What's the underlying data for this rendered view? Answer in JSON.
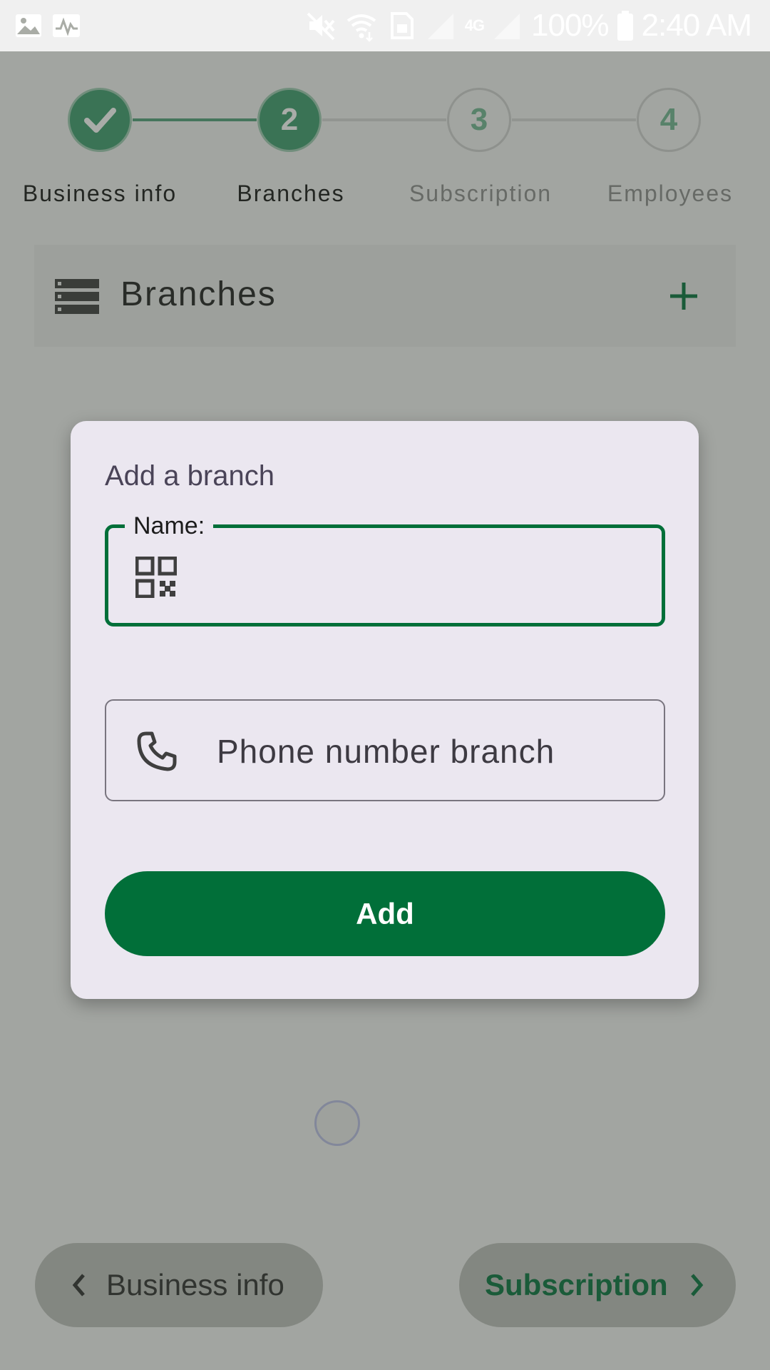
{
  "status_bar": {
    "battery": "100%",
    "time": "2:40 AM",
    "network": "4G",
    "icons": [
      "image-icon",
      "activity-icon",
      "mute-icon",
      "wifi-icon",
      "sim-icon",
      "signal-icon",
      "battery-icon"
    ]
  },
  "stepper": {
    "steps": [
      {
        "number": "",
        "label": "Business info",
        "state": "completed"
      },
      {
        "number": "2",
        "label": "Branches",
        "state": "active"
      },
      {
        "number": "3",
        "label": "Subscription",
        "state": "upcoming"
      },
      {
        "number": "4",
        "label": "Employees",
        "state": "upcoming"
      }
    ]
  },
  "branches_section": {
    "title": "Branches",
    "icons": [
      "list-icon",
      "plus-icon"
    ]
  },
  "dialog": {
    "title": "Add a branch",
    "name_field": {
      "label": "Name:",
      "value": "",
      "icon": "qr-code-icon"
    },
    "phone_field": {
      "placeholder": "Phone number branch",
      "value": "",
      "icon": "phone-icon"
    },
    "add_button": "Add"
  },
  "bottom_nav": {
    "back_label": "Business info",
    "next_label": "Subscription"
  },
  "colors": {
    "primary": "#016F39",
    "dialog_bg": "#EBE7F0",
    "scrim": "rgba(60,66,58,0.44)"
  }
}
